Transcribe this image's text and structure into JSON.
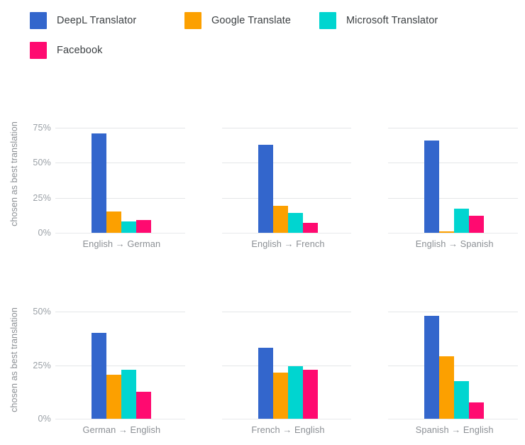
{
  "legend": {
    "items": [
      {
        "label": "DeepL Translator",
        "color": "#3366cc"
      },
      {
        "label": "Google Translate",
        "color": "#fca000"
      },
      {
        "label": "Microsoft Translator",
        "color": "#00d5d0"
      },
      {
        "label": "Facebook",
        "color": "#ff0a70"
      }
    ]
  },
  "chart_data": {
    "type": "bar",
    "title": "",
    "xlabel": "",
    "ylabel": "chosen as best translation",
    "grid": true,
    "legend_position": "top-left",
    "series_names": [
      "DeepL Translator",
      "Google Translate",
      "Microsoft Translator",
      "Facebook"
    ],
    "series_colors": [
      "#3366cc",
      "#fca000",
      "#00d5d0",
      "#ff0a70"
    ],
    "panel_rows": [
      {
        "ylabel": "chosen as best translation",
        "ylim": [
          0,
          81
        ],
        "yticks": [
          0,
          25,
          50,
          75
        ],
        "yticklabels": [
          "0%",
          "25%",
          "50%",
          "75%"
        ],
        "panels": [
          {
            "category": "English → German",
            "values": [
              71,
              15,
              8,
              9
            ]
          },
          {
            "category": "English → French",
            "values": [
              63,
              19,
              14,
              7
            ]
          },
          {
            "category": "English → Spanish",
            "values": [
              66,
              1,
              17,
              12
            ]
          }
        ]
      },
      {
        "ylabel": "chosen as best translation",
        "ylim": [
          0,
          53
        ],
        "yticks": [
          0,
          25,
          50
        ],
        "yticklabels": [
          "0%",
          "25%",
          "50%"
        ],
        "panels": [
          {
            "category": "German → English",
            "values": [
              40,
              20.5,
              23,
              12.5
            ]
          },
          {
            "category": "French → English",
            "values": [
              33,
              21.5,
              24.5,
              23
            ]
          },
          {
            "category": "Spanish → English",
            "values": [
              48,
              29,
              17.5,
              7.5
            ]
          }
        ]
      }
    ]
  }
}
